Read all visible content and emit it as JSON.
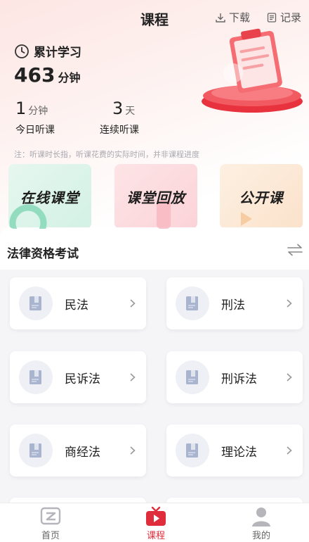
{
  "header": {
    "title": "课程",
    "download_label": "下载",
    "record_label": "记录"
  },
  "stats": {
    "title": "累计学习",
    "total_value": "463",
    "total_unit": "分钟",
    "today_value": "1",
    "today_unit": "分钟",
    "today_label": "今日听课",
    "streak_value": "3",
    "streak_unit": "天",
    "streak_label": "连续听课",
    "note": "注：听课时长指，听课花费的实际时间，并非课程进度"
  },
  "cards": [
    {
      "label": "在线课堂",
      "color": "#d3f1e4"
    },
    {
      "label": "课堂回放",
      "color": "#fbd3d8"
    },
    {
      "label": "公开课",
      "color": "#fbe2cb"
    }
  ],
  "exam": {
    "title": "法律资格考试",
    "subjects": [
      {
        "label": "民法"
      },
      {
        "label": "刑法"
      },
      {
        "label": "民诉法"
      },
      {
        "label": "刑诉法"
      },
      {
        "label": "商经法"
      },
      {
        "label": "理论法"
      }
    ]
  },
  "tabs": [
    {
      "label": "首页",
      "icon": "home-logo-icon",
      "active": false
    },
    {
      "label": "课程",
      "icon": "tv-icon",
      "active": true
    },
    {
      "label": "我的",
      "icon": "person-icon",
      "active": false
    }
  ],
  "colors": {
    "accent": "#e02d3c",
    "text": "#222222",
    "muted": "#a9a9b0"
  }
}
